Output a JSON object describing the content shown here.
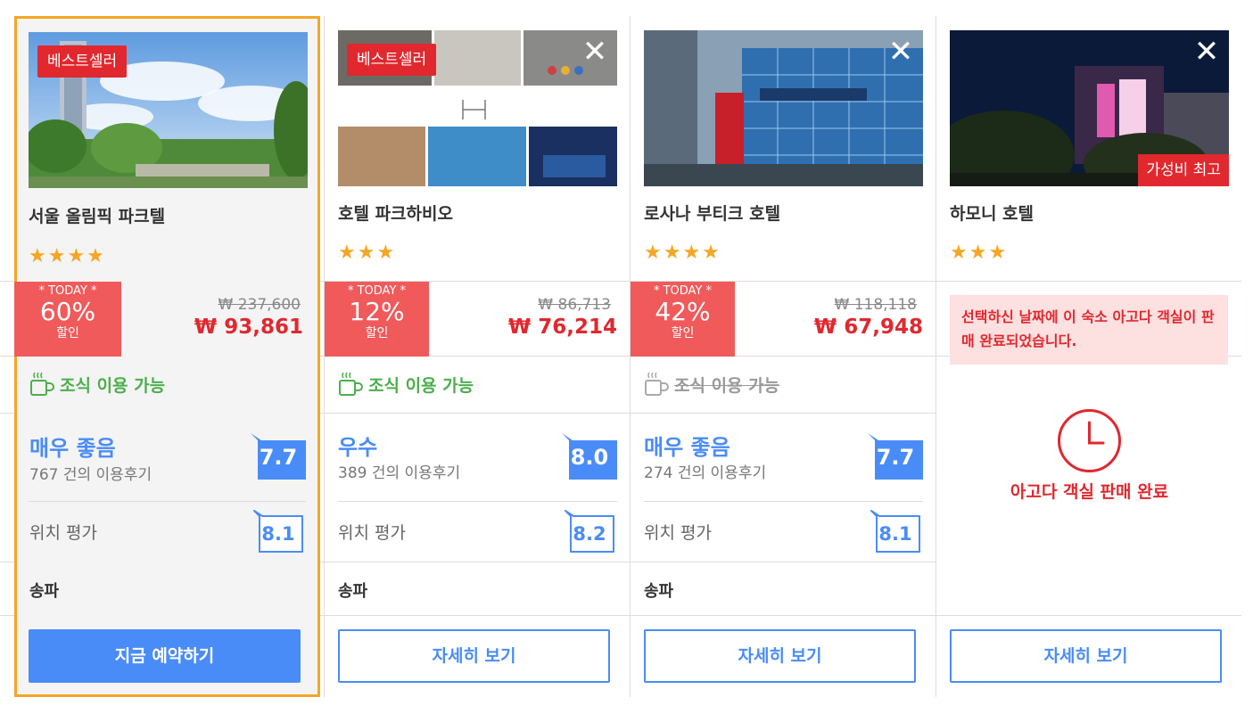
{
  "hotels": [
    {
      "name": "서울 올림픽 파크텔",
      "badge": "베스트셀러",
      "stars": "★★★★",
      "today_label": "* TODAY *",
      "discount_pct": "60%",
      "discount_label": "할인",
      "price_old": "₩ 237,600",
      "price_new": "₩ 93,861",
      "breakfast": "조식 이용 가능",
      "rating_word": "매우 좋음",
      "reviews": "767 건의 이용후기",
      "score": "7.7",
      "location_label": "위치 평가",
      "location_score": "8.1",
      "area": "송파",
      "button": "지금 예약하기"
    },
    {
      "name": "호텔 파크하비오",
      "badge": "베스트셀러",
      "close": "✕",
      "stars": "★★★",
      "today_label": "* TODAY *",
      "discount_pct": "12%",
      "discount_label": "할인",
      "price_old": "₩ 86,713",
      "price_new": "₩ 76,214",
      "breakfast": "조식 이용 가능",
      "rating_word": "우수",
      "reviews": "389 건의 이용후기",
      "score": "8.0",
      "location_label": "위치 평가",
      "location_score": "8.2",
      "area": "송파",
      "button": "자세히 보기"
    },
    {
      "name": "로사나 부티크 호텔",
      "close": "✕",
      "stars": "★★★★",
      "today_label": "* TODAY *",
      "discount_pct": "42%",
      "discount_label": "할인",
      "price_old": "₩ 118,118",
      "price_new": "₩ 67,948",
      "breakfast": "조식 이용 가능",
      "rating_word": "매우 좋음",
      "reviews": "274 건의 이용후기",
      "score": "7.7",
      "location_label": "위치 평가",
      "location_score": "8.1",
      "area": "송파",
      "button": "자세히 보기"
    },
    {
      "name": "하모니 호텔",
      "badge_value": "가성비 최고",
      "close": "✕",
      "stars": "★★★",
      "soldout_note": "선택하신 날짜에 이 숙소 아고다 객실이 판매 완료되었습니다.",
      "soldout_label": "아고다 객실 판매 완료",
      "button": "자세히 보기"
    }
  ],
  "colors": {
    "accent_blue": "#4a8cf7",
    "discount_red": "#f05a5b",
    "price_red": "#e0282e",
    "star_orange": "#f5a623",
    "breakfast_green": "#4cae4c",
    "selected_border": "#f5a623"
  }
}
